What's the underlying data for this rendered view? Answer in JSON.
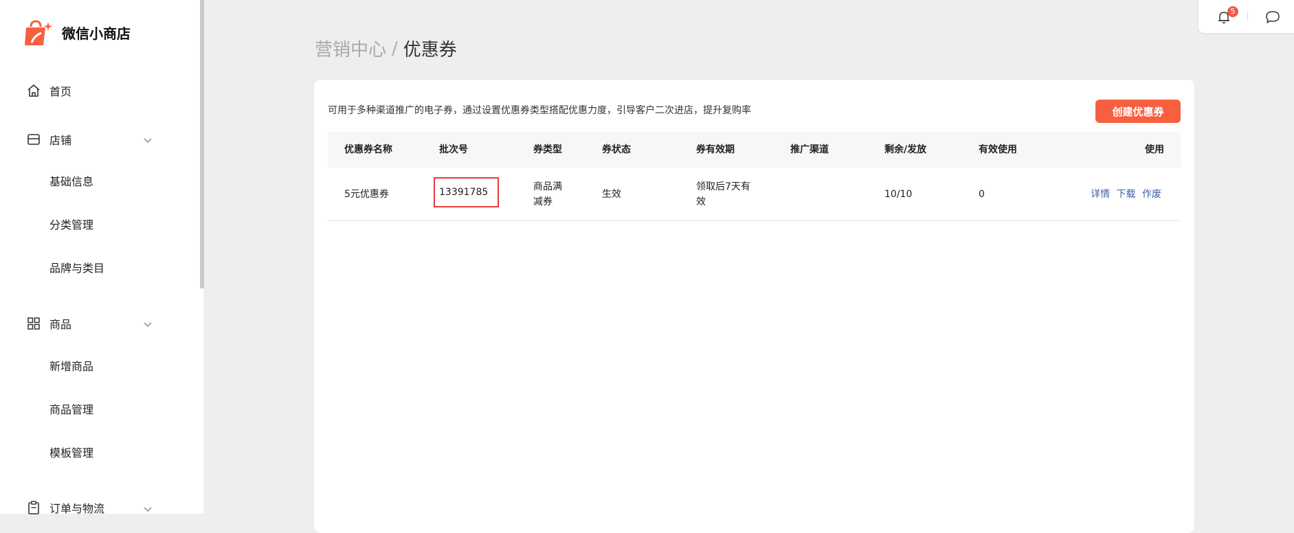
{
  "app": {
    "name": "微信小商店",
    "brand_color": "#f7603f"
  },
  "sidebar": {
    "items": [
      {
        "label": "首页",
        "icon": "home-icon"
      },
      {
        "label": "店铺",
        "icon": "store-icon",
        "children": [
          "基础信息",
          "分类管理",
          "品牌与类目"
        ]
      },
      {
        "label": "商品",
        "icon": "grid-icon",
        "children": [
          "新增商品",
          "商品管理",
          "模板管理"
        ]
      },
      {
        "label": "订单与物流",
        "icon": "clipboard-icon"
      }
    ]
  },
  "topbar": {
    "notification_count": "5"
  },
  "breadcrumb": {
    "parent": "营销中心",
    "separator": "/",
    "current": "优惠券"
  },
  "main": {
    "description": "可用于多种渠道推广的电子券，通过设置优惠券类型搭配优惠力度，引导客户二次进店，提升复购率",
    "create_button": "创建优惠券",
    "table": {
      "columns": [
        "优惠券名称",
        "批次号",
        "券类型",
        "券状态",
        "券有效期",
        "推广渠道",
        "剩余/发放",
        "有效使用",
        "使用"
      ],
      "rows": [
        {
          "name": "5元优惠券",
          "batch": "13391785",
          "type_line1": "商品满",
          "type_line2": "减券",
          "status": "生效",
          "validity_line1": "领取后7天有",
          "validity_line2": "效",
          "channel": "",
          "remaining": "10/10",
          "used": "0",
          "actions": [
            "详情",
            "下载",
            "作废"
          ]
        }
      ]
    }
  }
}
